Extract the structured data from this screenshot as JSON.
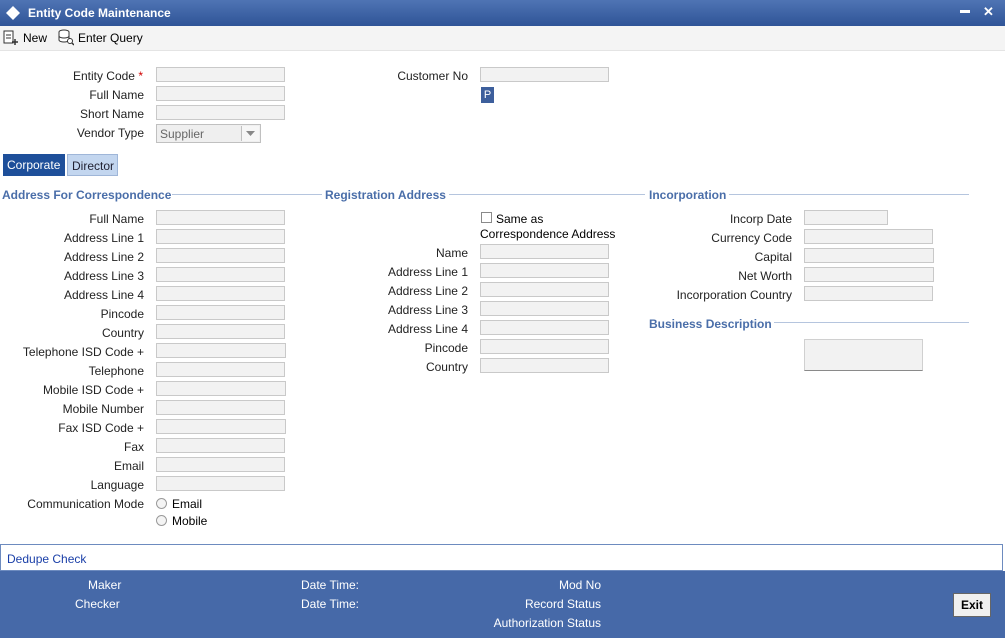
{
  "window": {
    "title": "Entity Code Maintenance",
    "minimize_glyph": "▬",
    "close_glyph": "✕"
  },
  "toolbar": {
    "new_label": "New",
    "enter_query_label": "Enter Query"
  },
  "header": {
    "entity_code_label": "Entity Code",
    "required_mark": "*",
    "full_name_label": "Full Name",
    "short_name_label": "Short Name",
    "vendor_type_label": "Vendor Type",
    "vendor_type_value": "Supplier",
    "customer_no_label": "Customer No",
    "lookup_button_label": "P"
  },
  "tabs": [
    {
      "label": "Corporate",
      "active": true
    },
    {
      "label": "Director",
      "active": false
    }
  ],
  "correspondence": {
    "title": "Address For Correspondence",
    "full_name": "Full Name",
    "address_line_1": "Address Line 1",
    "address_line_2": "Address Line 2",
    "address_line_3": "Address Line 3",
    "address_line_4": "Address Line 4",
    "pincode": "Pincode",
    "country": "Country",
    "telephone_isd": "Telephone ISD Code +",
    "telephone": "Telephone",
    "mobile_isd": "Mobile ISD Code +",
    "mobile_number": "Mobile Number",
    "fax_isd": "Fax ISD Code +",
    "fax": "Fax",
    "email": "Email",
    "language": "Language",
    "communication_mode": "Communication Mode",
    "mode_email": "Email",
    "mode_mobile": "Mobile"
  },
  "registration": {
    "title": "Registration Address",
    "same_as_line1": "Same as",
    "same_as_line2": "Correspondence Address",
    "name": "Name",
    "address_line_1": "Address Line 1",
    "address_line_2": "Address Line 2",
    "address_line_3": "Address Line 3",
    "address_line_4": "Address Line 4",
    "pincode": "Pincode",
    "country": "Country"
  },
  "incorporation": {
    "title": "Incorporation",
    "incorp_date": "Incorp Date",
    "currency_code": "Currency Code",
    "capital": "Capital",
    "net_worth": "Net Worth",
    "incorporation_country": "Incorporation Country",
    "business_description_title": "Business Description"
  },
  "dedupe_link": "Dedupe Check",
  "footer": {
    "maker": "Maker",
    "checker": "Checker",
    "date_time_1": "Date Time:",
    "date_time_2": "Date Time:",
    "mod_no": "Mod No",
    "record_status": "Record Status",
    "authorization_status": "Authorization Status",
    "exit_label": "Exit"
  },
  "colors": {
    "title_bar": "#2f5497",
    "section_heading": "#4a6ea9",
    "footer": "#4669a8",
    "active_tab": "#1e4f9a",
    "link": "#1a3fa8",
    "required": "#d00000"
  }
}
